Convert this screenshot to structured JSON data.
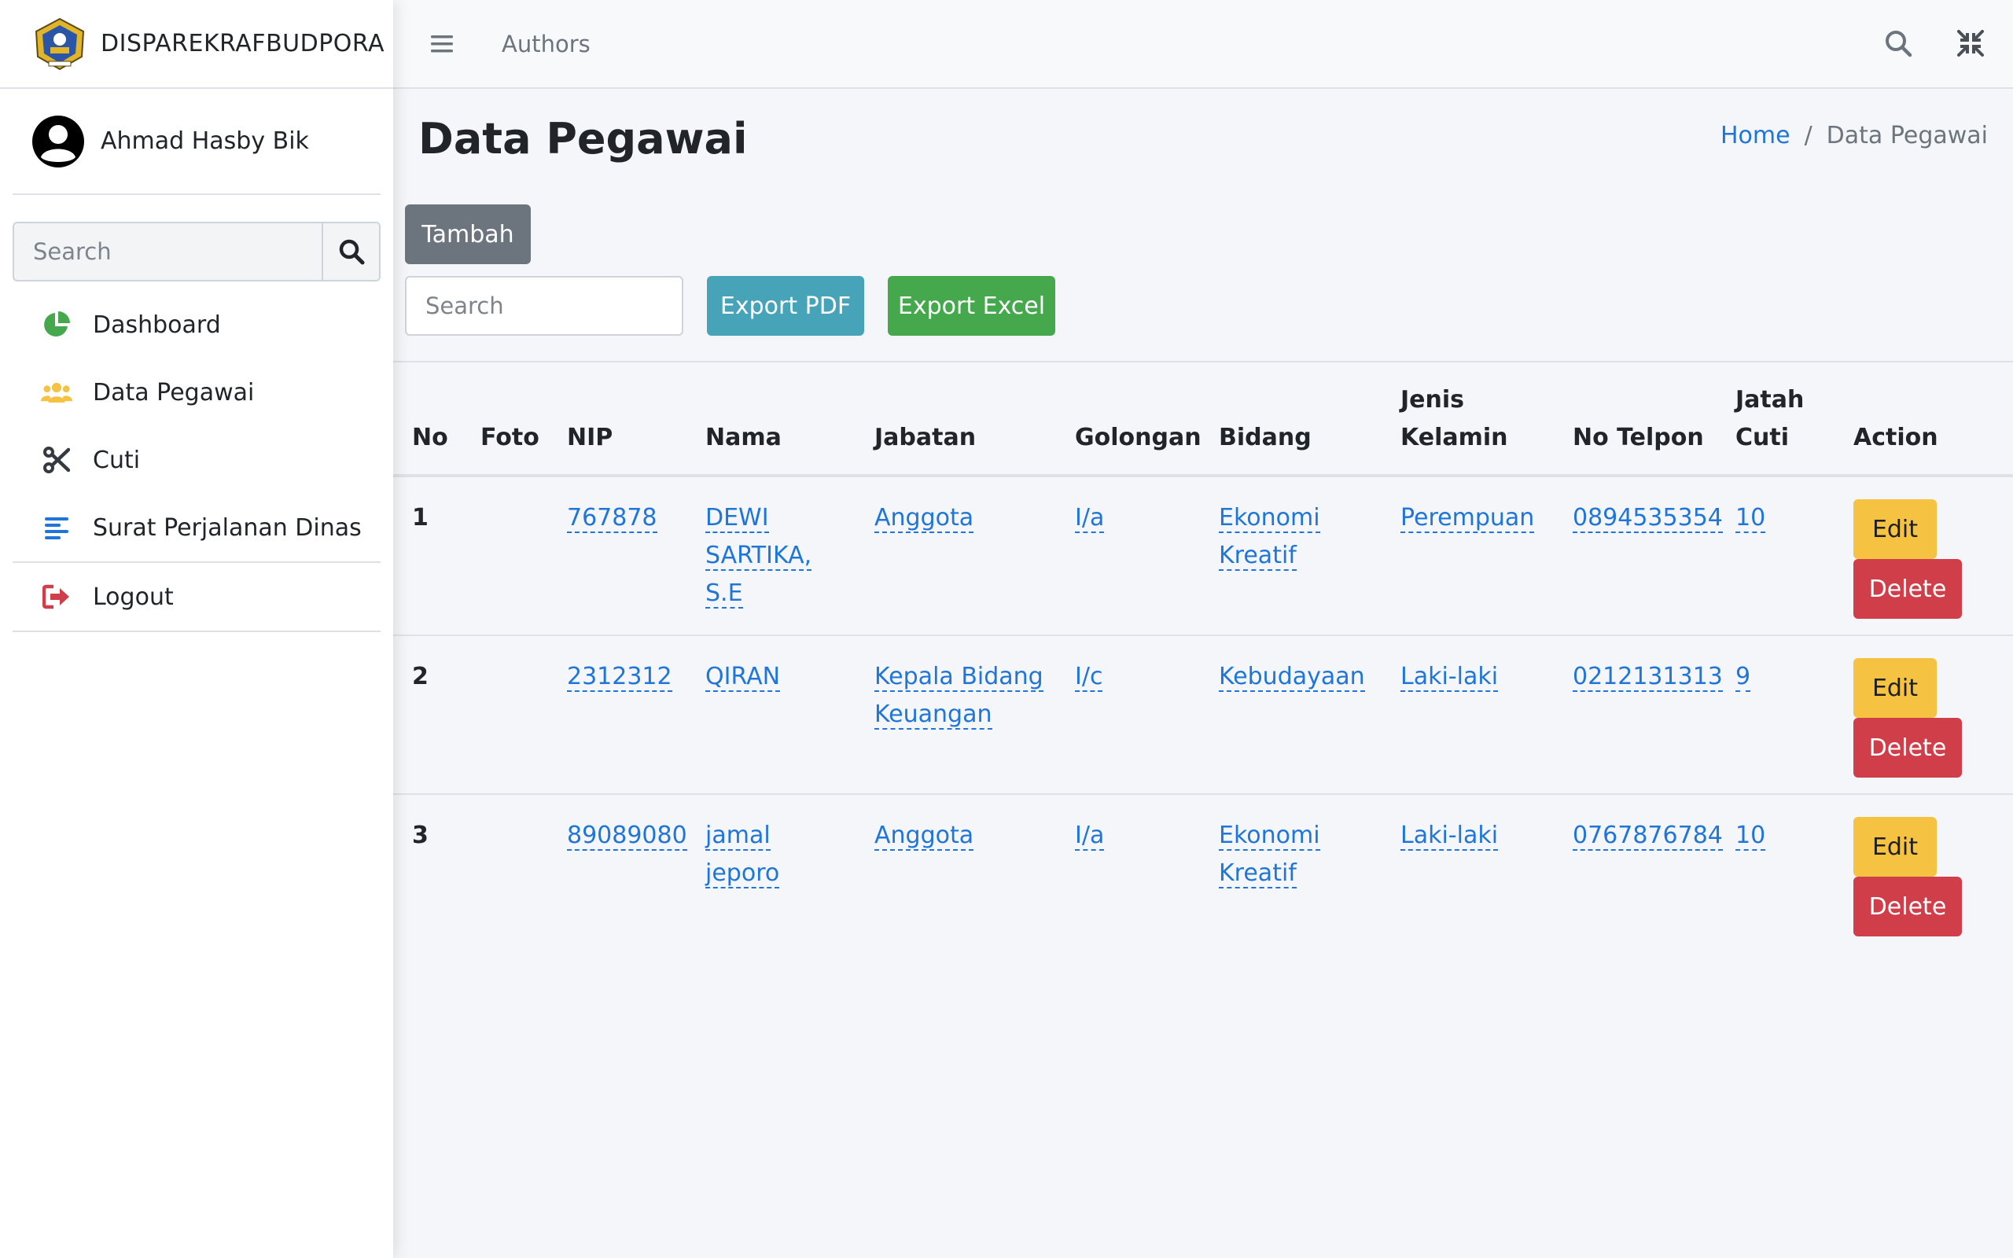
{
  "brand": {
    "name": "DISPAREKRAFBUDPORA"
  },
  "user": {
    "name": "Ahmad Hasby Bik"
  },
  "sidebar": {
    "search_placeholder": "Search",
    "items": [
      {
        "label": "Dashboard",
        "icon": "chart-pie-icon",
        "color": "#45a84d"
      },
      {
        "label": "Data Pegawai",
        "icon": "users-icon",
        "color": "#f5c242"
      },
      {
        "label": "Cuti",
        "icon": "scissors-icon",
        "color": "#343a40"
      },
      {
        "label": "Surat Perjalanan Dinas",
        "icon": "align-left-icon",
        "color": "#1f76d8"
      },
      {
        "label": "Logout",
        "icon": "sign-out-icon",
        "color": "#d03e49"
      }
    ]
  },
  "topbar": {
    "link": "Authors"
  },
  "page": {
    "title": "Data Pegawai",
    "breadcrumb": {
      "home": "Home",
      "separator": "/",
      "current": "Data Pegawai"
    }
  },
  "toolbar": {
    "add_label": "Tambah",
    "search_placeholder": "Search",
    "export_pdf_label": "Export PDF",
    "export_excel_label": "Export Excel"
  },
  "table": {
    "headers": {
      "no": "No",
      "foto": "Foto",
      "nip": "NIP",
      "nama": "Nama",
      "jabatan": "Jabatan",
      "golongan": "Golongan",
      "bidang": "Bidang",
      "jenis_kelamin_1": "Jenis",
      "jenis_kelamin_2": "Kelamin",
      "no_telpon": "No Telpon",
      "jatah_cuti_1": "Jatah",
      "jatah_cuti_2": "Cuti",
      "action": "Action"
    },
    "rows": [
      {
        "no": "1",
        "nip": "767878",
        "nama": [
          "DEWI",
          "SARTIKA,",
          "S.E"
        ],
        "jabatan": [
          "Anggota"
        ],
        "golongan": "I/a",
        "bidang": [
          "Ekonomi",
          "Kreatif"
        ],
        "jenis_kelamin": "Perempuan",
        "no_telpon": "0894535354",
        "jatah_cuti": "10"
      },
      {
        "no": "2",
        "nip": "2312312",
        "nama": [
          "QIRAN"
        ],
        "jabatan": [
          "Kepala Bidang",
          "Keuangan"
        ],
        "golongan": "I/c",
        "bidang": [
          "Kebudayaan"
        ],
        "jenis_kelamin": "Laki-laki",
        "no_telpon": "0212131313",
        "jatah_cuti": "9"
      },
      {
        "no": "3",
        "nip": "89089080",
        "nama": [
          "jamal",
          "jeporo"
        ],
        "jabatan": [
          "Anggota"
        ],
        "golongan": "I/a",
        "bidang": [
          "Ekonomi",
          "Kreatif"
        ],
        "jenis_kelamin": "Laki-laki",
        "no_telpon": "0767876784",
        "jatah_cuti": "10"
      }
    ],
    "edit_label": "Edit",
    "delete_label": "Delete"
  }
}
